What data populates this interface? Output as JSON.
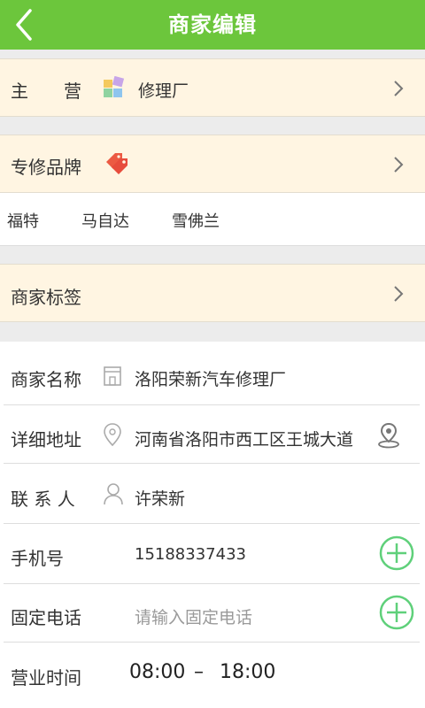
{
  "header": {
    "title": "商家编辑",
    "back_icon": "back-chevron-icon"
  },
  "main_business": {
    "label": "主　　营",
    "value": "修理厂",
    "icon": "category-blocks-icon"
  },
  "brands": {
    "label": "专修品牌",
    "icon": "price-tag-icon",
    "items": [
      "福特",
      "马自达",
      "雪佛兰"
    ]
  },
  "tags": {
    "label": "商家标签"
  },
  "form": {
    "name": {
      "label": "商家名称",
      "value": "洛阳荣新汽车修理厂",
      "icon": "building-icon"
    },
    "address": {
      "label": "详细地址",
      "value": "河南省洛阳市西工区王城大道",
      "icon": "location-pin-icon",
      "action_icon": "map-locate-icon"
    },
    "contact": {
      "label": "联 系 人",
      "value": "许荣新",
      "icon": "person-icon"
    },
    "mobile": {
      "label": "手机号",
      "value": "15188337433",
      "action_icon": "add-circle-icon"
    },
    "landline": {
      "label": "固定电话",
      "placeholder": "请输入固定电话",
      "action_icon": "add-circle-icon"
    },
    "hours": {
      "label": "营业时间",
      "start": "08:00",
      "separator": "–",
      "end": "18:00"
    }
  },
  "colors": {
    "header_bg": "#6cc63c",
    "section_bg": "#fff5e2",
    "accent_green": "#5fd07a",
    "tag_red": "#ec5a43"
  }
}
